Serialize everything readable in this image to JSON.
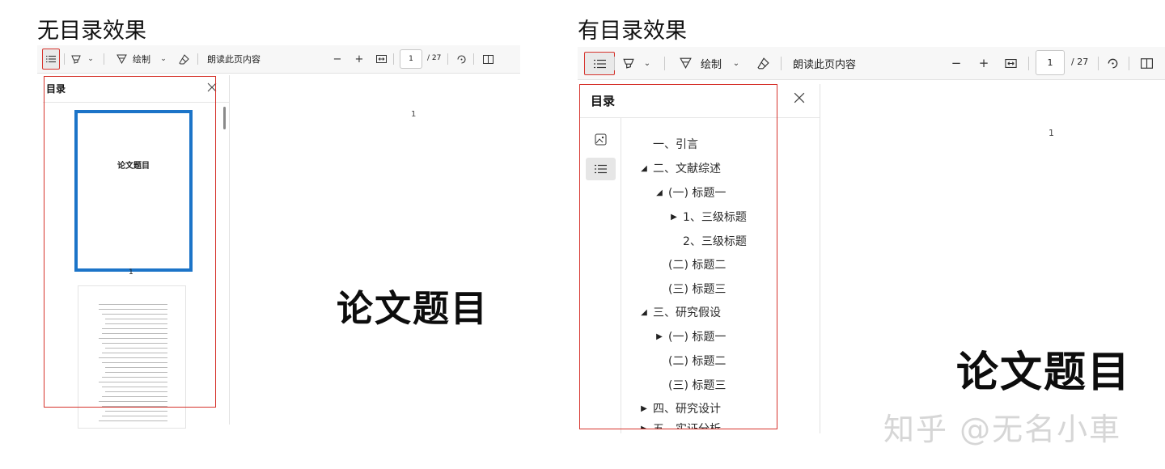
{
  "left": {
    "caption": "无目录效果",
    "toolbar": {
      "draw_label": "绘制",
      "read_aloud": "朗读此页内容",
      "page_value": "1",
      "page_total": "/ 27"
    },
    "sidebar": {
      "title": "目录",
      "thumb1_title": "论文题目",
      "thumb1_label": "1"
    },
    "document": {
      "page_number": "1",
      "title": "论文题目"
    }
  },
  "right": {
    "caption": "有目录效果",
    "toolbar": {
      "draw_label": "绘制",
      "read_aloud": "朗读此页内容",
      "page_value": "1",
      "page_total": "/ 27"
    },
    "sidebar": {
      "title": "目录",
      "toc": [
        {
          "label": "一、引言",
          "caret": ""
        },
        {
          "label": "二、文献综述",
          "caret": "expanded"
        },
        {
          "label": "(一) 标题一",
          "caret": "expanded"
        },
        {
          "label": "1、三级标题",
          "caret": "collapsed"
        },
        {
          "label": "2、三级标题",
          "caret": ""
        },
        {
          "label": "(二) 标题二",
          "caret": ""
        },
        {
          "label": "(三) 标题三",
          "caret": ""
        },
        {
          "label": "三、研究假设",
          "caret": "expanded"
        },
        {
          "label": "(一) 标题一",
          "caret": "collapsed"
        },
        {
          "label": "(二) 标题二",
          "caret": ""
        },
        {
          "label": "(三) 标题三",
          "caret": ""
        },
        {
          "label": "四、研究设计",
          "caret": "collapsed"
        },
        {
          "label": "五、实证分析",
          "caret": "collapsed"
        }
      ]
    },
    "document": {
      "page_number": "1",
      "title": "论文题目"
    }
  },
  "watermark": "知乎 @无名小車"
}
